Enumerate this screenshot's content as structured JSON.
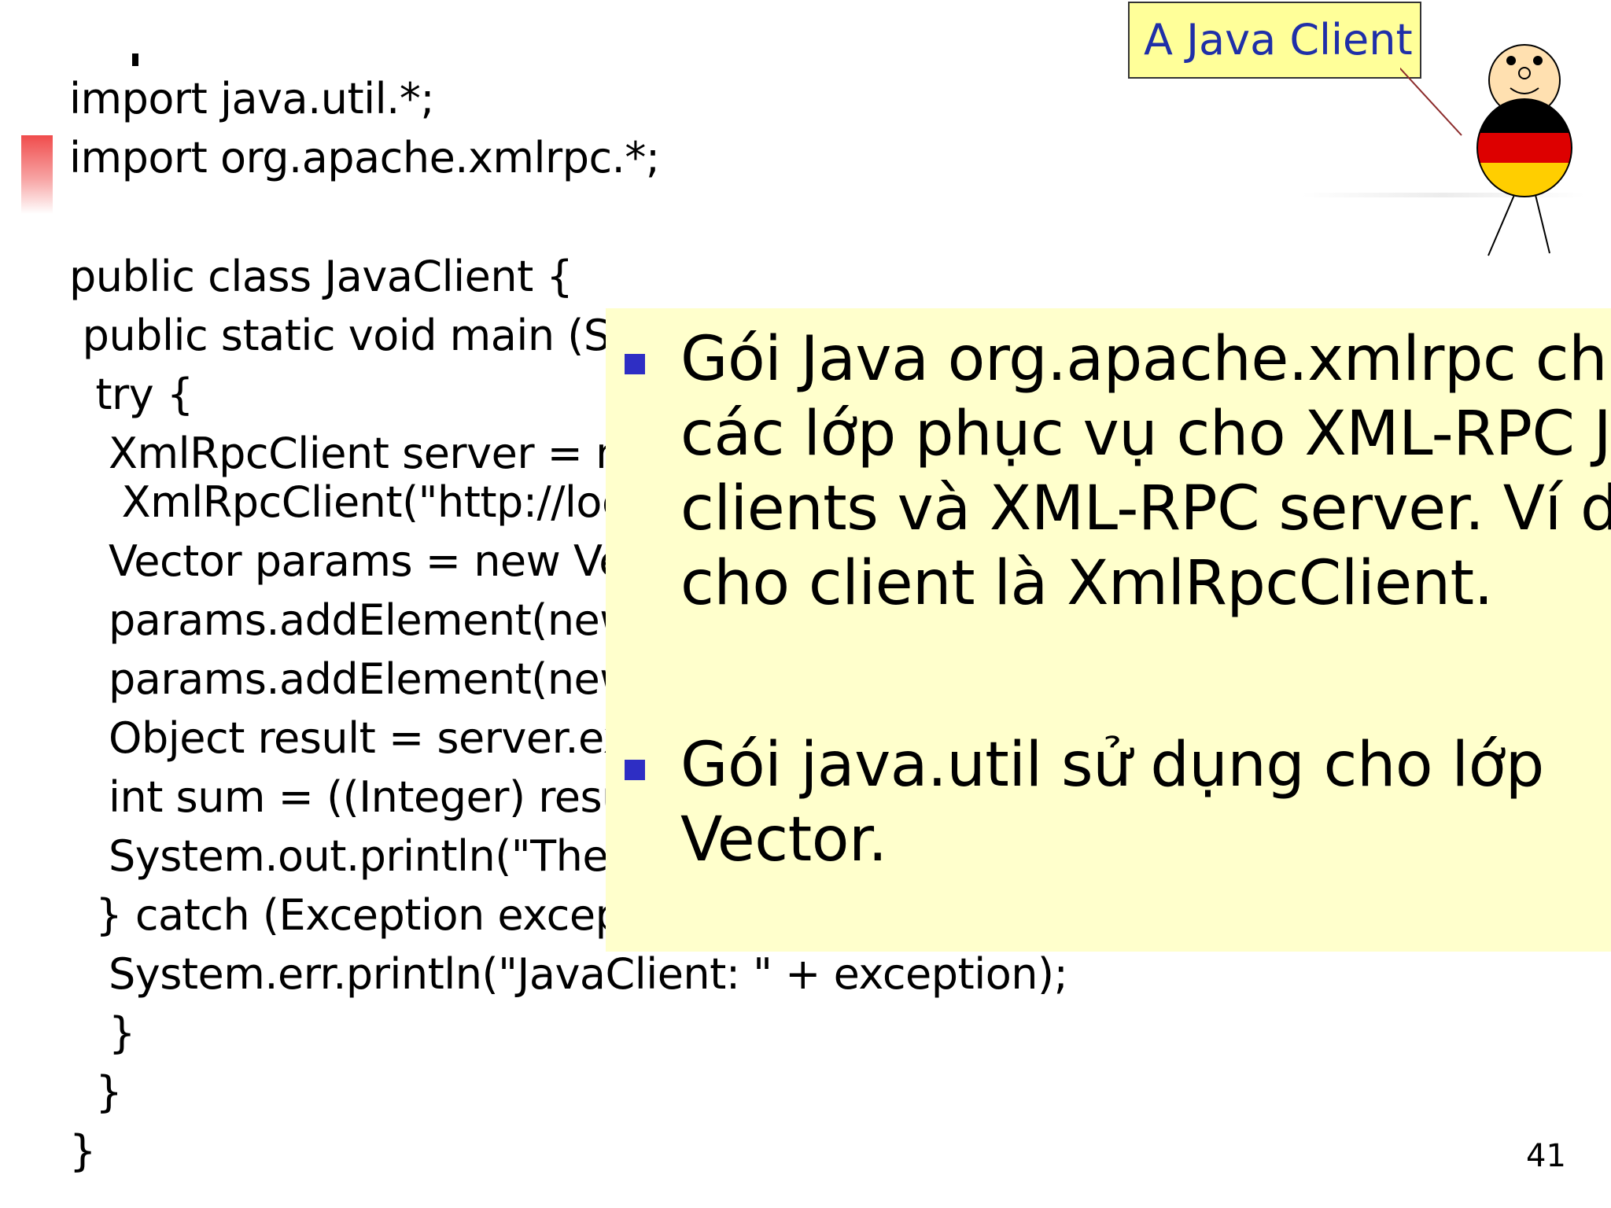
{
  "code_lines": [
    "import java.util.*;",
    "import org.apache.xmlrpc.*;",
    "public class JavaClient {",
    " public static void main (Str",
    "  try {",
    "   XmlRpcClient server = ne",
    "    XmlRpcClient(\"http://loc",
    "   Vector params = new Ve",
    "   params.addElement(new",
    "   params.addElement(new",
    "   Object result = server.ex",
    "   int sum = ((Integer) resu",
    "   System.out.println(\"The s",
    "  } catch (Exception except",
    "   System.err.println(\"JavaClient: \" + exception);",
    "   }",
    "  }",
    "}"
  ],
  "callout": {
    "label": "A Java Client"
  },
  "overlay": {
    "bullets": [
      {
        "lines": [
          "Gói Java org.apache.xmlrpc chứa",
          "các lớp phục vụ cho XML-RPC Jav",
          "clients và XML-RPC server. Ví dụ,",
          "cho client là XmlRpcClient."
        ]
      },
      {
        "lines": [
          "Gói java.util sử dụng cho lớp",
          "Vector."
        ]
      }
    ]
  },
  "page_number": "41",
  "colors": {
    "callout_background": "#ffff99",
    "callout_text": "#1f2fa8",
    "overlay_background": "#ffffcc",
    "bullet": "#2e2ec4",
    "accent_red": "#f04c4c",
    "flag_black": "#000000",
    "flag_red": "#dd0000",
    "flag_gold": "#ffce00"
  }
}
